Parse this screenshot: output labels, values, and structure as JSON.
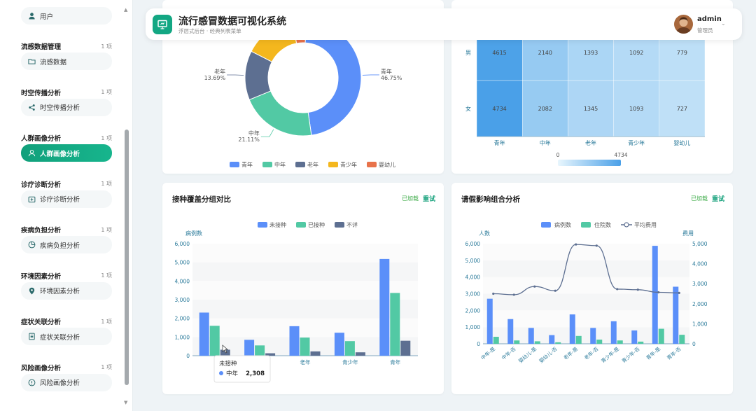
{
  "app": {
    "title": "流行感冒数据可视化系统",
    "subtitle": "浮层式后台 · 经典列表菜单",
    "user": "admin",
    "role": "管理员"
  },
  "sidebar": {
    "top_item": "用户",
    "groups": [
      {
        "title": "流感数据管理",
        "count": "1 项",
        "item": "流感数据",
        "icon": "folder-icon"
      },
      {
        "title": "时空传播分析",
        "count": "1 项",
        "item": "时空传播分析",
        "icon": "share-icon"
      },
      {
        "title": "人群画像分析",
        "count": "1 项",
        "item": "人群画像分析",
        "icon": "user-icon",
        "active": true
      },
      {
        "title": "诊疗诊断分析",
        "count": "1 项",
        "item": "诊疗诊断分析",
        "icon": "medical-icon"
      },
      {
        "title": "疾病负担分析",
        "count": "1 项",
        "item": "疾病负担分析",
        "icon": "pie-icon"
      },
      {
        "title": "环境因素分析",
        "count": "1 项",
        "item": "环境因素分析",
        "icon": "location-icon"
      },
      {
        "title": "症状关联分析",
        "count": "1 项",
        "item": "症状关联分析",
        "icon": "list-icon"
      },
      {
        "title": "风险画像分析",
        "count": "1 项",
        "item": "风险画像分析",
        "icon": "alert-icon"
      }
    ]
  },
  "status": {
    "loaded": "已加载",
    "retry": "重试"
  },
  "chart_data": [
    {
      "type": "pie",
      "donut": true,
      "labels": [
        "青年",
        "中年",
        "老年",
        "青少年",
        "婴幼儿"
      ],
      "values": [
        46.75,
        21.11,
        13.69,
        14.5,
        3.95
      ],
      "label_text": {
        "青年": "46.75%",
        "中年": "21.11%",
        "老年": "13.69%"
      },
      "colors": [
        "#5b8ff9",
        "#52c9a4",
        "#5d6f91",
        "#f4b71e",
        "#e8724a"
      ]
    },
    {
      "type": "heatmap",
      "rows": [
        "男",
        "女"
      ],
      "cols": [
        "青年",
        "中年",
        "老年",
        "青少年",
        "婴幼儿"
      ],
      "values": [
        [
          4615,
          2140,
          1393,
          1092,
          779
        ],
        [
          4734,
          2082,
          1345,
          1093,
          727
        ]
      ],
      "scale": {
        "min": "0",
        "max": "4734"
      }
    },
    {
      "type": "bar",
      "title": "接种覆盖分组对比",
      "ylabel": "病例数",
      "ylim": [
        0,
        6000
      ],
      "yticks": [
        "0",
        "1,000",
        "2,000",
        "3,000",
        "4,000",
        "5,000",
        "6,000"
      ],
      "categories": [
        "中年",
        "老年",
        "青少年",
        "青年"
      ],
      "group_slots": 5,
      "visible_labels": [
        "老年",
        "青少年",
        "青年"
      ],
      "series": [
        {
          "name": "未接种",
          "color": "#5b8ff9",
          "values": [
            2308,
            850,
            1580,
            1230,
            5180
          ]
        },
        {
          "name": "已接种",
          "color": "#52c9a4",
          "values": [
            1600,
            550,
            970,
            780,
            3360
          ]
        },
        {
          "name": "不详",
          "color": "#5d6f91",
          "values": [
            320,
            130,
            230,
            180,
            800
          ]
        }
      ],
      "tooltip": {
        "title": "未接种",
        "series": "中年",
        "value": "2,308"
      }
    },
    {
      "type": "bar+line",
      "title": "请假影响组合分析",
      "ylabel": "人数",
      "y2label": "费用",
      "ylim": [
        0,
        6000
      ],
      "y2lim": [
        0,
        5000
      ],
      "yticks": [
        "0",
        "1,000",
        "2,000",
        "3,000",
        "4,000",
        "5,000",
        "6,000"
      ],
      "y2ticks": [
        "0",
        "1,000",
        "2,000",
        "3,000",
        "4,000",
        "5,000"
      ],
      "categories": [
        "中年-是",
        "中年-否",
        "婴幼儿-是",
        "婴幼儿-否",
        "老年-是",
        "老年-否",
        "青少年-是",
        "青少年-否",
        "青年-是",
        "青年-否"
      ],
      "series": [
        {
          "name": "病例数",
          "color": "#5b8ff9",
          "values": [
            2700,
            1480,
            950,
            520,
            1760,
            950,
            1350,
            800,
            5870,
            3420
          ]
        },
        {
          "name": "住院数",
          "color": "#52c9a4",
          "values": [
            420,
            200,
            150,
            90,
            470,
            250,
            200,
            130,
            900,
            540
          ]
        },
        {
          "name": "平均费用",
          "color": "#5d6f91",
          "values": [
            2500,
            2450,
            2860,
            2650,
            4960,
            4900,
            2730,
            2700,
            2570,
            2540
          ]
        }
      ]
    }
  ]
}
